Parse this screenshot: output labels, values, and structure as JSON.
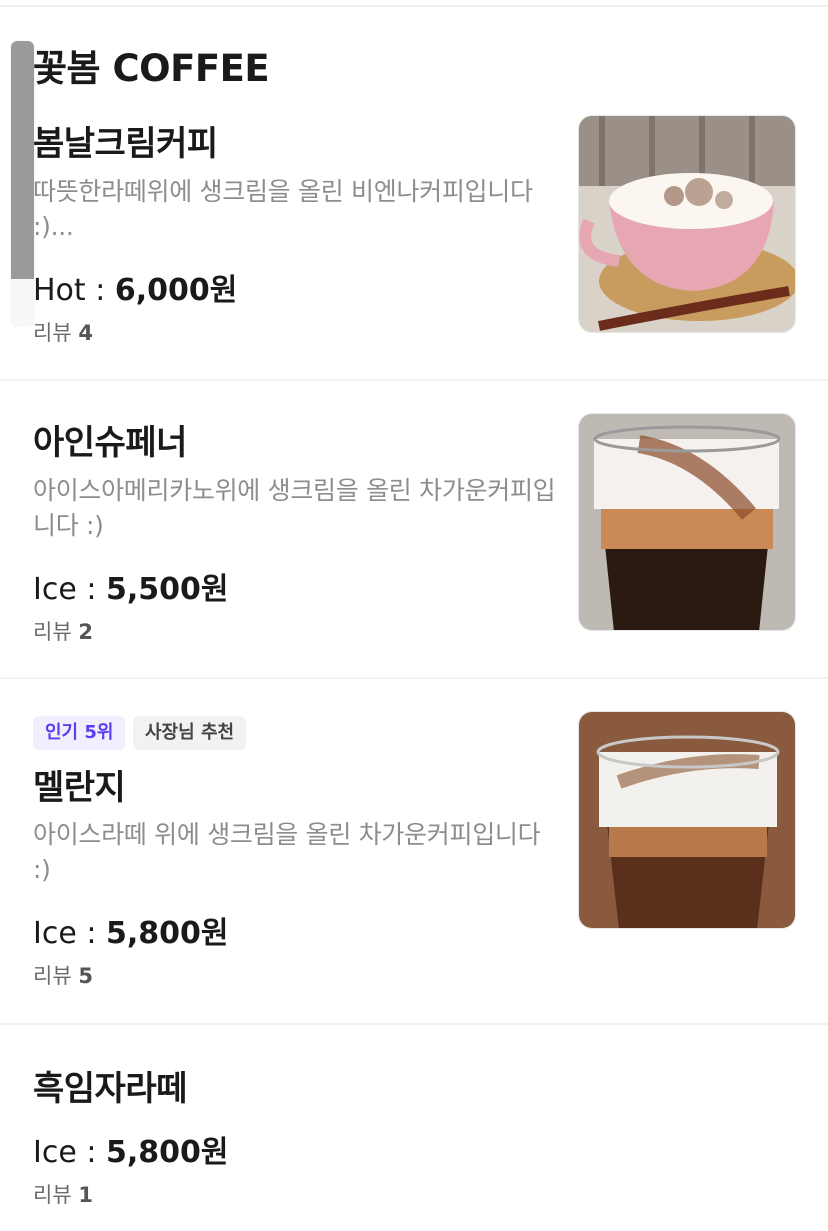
{
  "section": {
    "title": "꽃봄 COFFEE"
  },
  "items": [
    {
      "name": "봄날크림커피",
      "description": "따뜻한라떼위에 생크림을 올린 비엔나커피입니다 :)...",
      "price_label": "Hot : ",
      "price_value": "6,000원",
      "review_label": "리뷰 ",
      "review_count": "4",
      "image_alt": "cappuccino-cup-photo"
    },
    {
      "name": "아인슈페너",
      "description": "아이스아메리카노위에 생크림을 올린  차가운커피입니다 :)",
      "price_label": "Ice : ",
      "price_value": "5,500원",
      "review_label": "리뷰 ",
      "review_count": "2",
      "image_alt": "iced-einspanner-photo"
    },
    {
      "name": "멜란지",
      "description": "아이스라떼 위에 생크림을 올린  차가운커피입니다 :)",
      "price_label": "Ice : ",
      "price_value": "5,800원",
      "review_label": "리뷰 ",
      "review_count": "5",
      "badges": [
        "인기 5위",
        "사장님 추천"
      ],
      "image_alt": "iced-melange-photo"
    },
    {
      "name": "흑임자라떼",
      "price_label": "Ice : ",
      "price_value": "5,800원",
      "review_label": "리뷰 ",
      "review_count": "1"
    }
  ],
  "colors": {
    "badge_popular_bg": "#f1efff",
    "badge_popular_text": "#5b3cf0",
    "muted_text": "#8d8d8d"
  }
}
